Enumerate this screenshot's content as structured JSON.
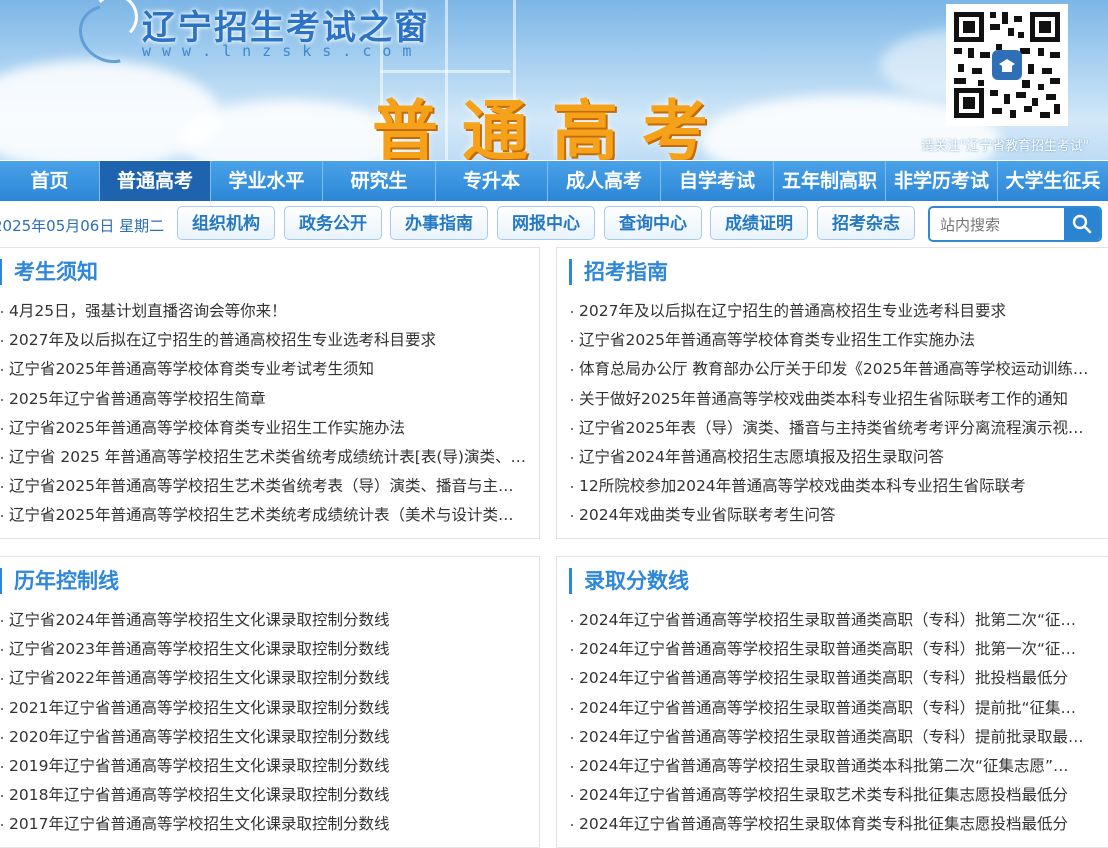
{
  "site": {
    "name": "辽宁招生考试之窗",
    "url": "www.lnzsks.com",
    "banner_title": "普通高考",
    "qr_caption": "请关注\"辽宁省教育招生考试\""
  },
  "nav": {
    "items": [
      {
        "label": "首页"
      },
      {
        "label": "普通高考",
        "active": true
      },
      {
        "label": "学业水平"
      },
      {
        "label": "研究生"
      },
      {
        "label": "专升本"
      },
      {
        "label": "成人高考"
      },
      {
        "label": "自学考试"
      },
      {
        "label": "五年制高职"
      },
      {
        "label": "非学历考试"
      },
      {
        "label": "大学生征兵"
      }
    ]
  },
  "subbar": {
    "date": "2025年05月06日  星期二",
    "buttons": [
      {
        "label": "组织机构"
      },
      {
        "label": "政务公开"
      },
      {
        "label": "办事指南"
      },
      {
        "label": "网报中心"
      },
      {
        "label": "查询中心"
      },
      {
        "label": "成绩证明"
      },
      {
        "label": "招考杂志"
      }
    ],
    "search_placeholder": "站内搜索"
  },
  "panels": {
    "notice": {
      "title": "考生须知",
      "items": [
        "4月25日，强基计划直播咨询会等你来！",
        "2027年及以后拟在辽宁招生的普通高校招生专业选考科目要求",
        "辽宁省2025年普通高等学校体育类专业考试考生须知",
        "2025年辽宁省普通高等学校招生简章",
        "辽宁省2025年普通高等学校体育类专业招生工作实施办法",
        "辽宁省 2025 年普通高等学校招生艺术类省统考成绩统计表[表(导)演类、…",
        "辽宁省2025年普通高等学校招生艺术类省统考表（导）演类、播音与主…",
        "辽宁省2025年普通高等学校招生艺术类统考成绩统计表（美术与设计类…"
      ]
    },
    "guide": {
      "title": "招考指南",
      "items": [
        "2027年及以后拟在辽宁招生的普通高校招生专业选考科目要求",
        "辽宁省2025年普通高等学校体育类专业招生工作实施办法",
        "体育总局办公厅 教育部办公厅关于印发《2025年普通高等学校运动训练…",
        "关于做好2025年普通高等学校戏曲类本科专业招生省际联考工作的通知",
        "辽宁省2025年表（导）演类、播音与主持类省统考考评分离流程演示视…",
        "辽宁省2024年普通高校招生志愿填报及招生录取问答",
        "12所院校参加2024年普通高等学校戏曲类本科专业招生省际联考",
        "2024年戏曲类专业省际联考考生问答"
      ]
    },
    "control": {
      "title": "历年控制线",
      "items": [
        "辽宁省2024年普通高等学校招生文化课录取控制分数线",
        "辽宁省2023年普通高等学校招生文化课录取控制分数线",
        "辽宁省2022年普通高等学校招生文化课录取控制分数线",
        "2021年辽宁省普通高等学校招生文化课录取控制分数线",
        "2020年辽宁省普通高等学校招生文化课录取控制分数线",
        "2019年辽宁省普通高等学校招生文化课录取控制分数线",
        "2018年辽宁省普通高等学校招生文化课录取控制分数线",
        "2017年辽宁省普通高等学校招生文化课录取控制分数线"
      ]
    },
    "scores": {
      "title": "录取分数线",
      "items": [
        "2024年辽宁省普通高等学校招生录取普通类高职（专科）批第二次“征…",
        "2024年辽宁省普通高等学校招生录取普通类高职（专科）批第一次“征…",
        "2024年辽宁省普通高等学校招生录取普通类高职（专科）批投档最低分",
        "2024年辽宁省普通高等学校招生录取普通类高职（专科）提前批“征集…",
        "2024年辽宁省普通高等学校招生录取普通类高职（专科）提前批录取最…",
        "2024年辽宁省普通高等学校招生录取普通类本科批第二次“征集志愿”…",
        "2024年辽宁省普通高等学校招生录取艺术类专科批征集志愿投档最低分",
        "2024年辽宁省普通高等学校招生录取体育类专科批征集志愿投档最低分"
      ]
    }
  }
}
